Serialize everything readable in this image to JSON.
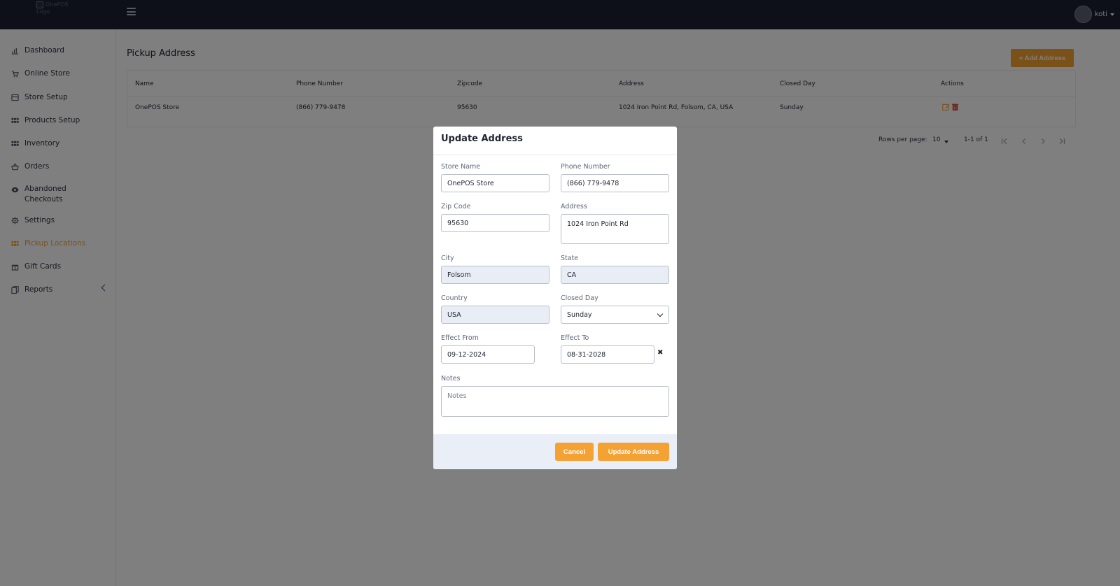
{
  "topbar": {
    "logo_alt": "OnePOS Logo",
    "username": "koti"
  },
  "sidebar": {
    "items": [
      {
        "label": "Dashboard",
        "icon": "bar-chart-icon"
      },
      {
        "label": "Online Store",
        "icon": "cart-icon"
      },
      {
        "label": "Store Setup",
        "icon": "store-icon"
      },
      {
        "label": "Products Setup",
        "icon": "grid-icon"
      },
      {
        "label": "Inventory",
        "icon": "grid-icon"
      },
      {
        "label": "Orders",
        "icon": "basket-icon"
      },
      {
        "label": "Abandoned Checkouts",
        "icon": "eye-icon"
      },
      {
        "label": "Settings",
        "icon": "gear-icon"
      },
      {
        "label": "Pickup Locations",
        "icon": "grid-icon",
        "active": true
      },
      {
        "label": "Gift Cards",
        "icon": "gift-icon"
      },
      {
        "label": "Reports",
        "icon": "report-icon"
      }
    ],
    "active_color": "#f2a33a"
  },
  "main": {
    "title": "Pickup Address",
    "add_button": "+ Add Address",
    "table": {
      "columns": [
        "Name",
        "Phone Number",
        "Zipcode",
        "Address",
        "Closed Day",
        "Actions"
      ],
      "rows": [
        [
          "OnePOS Store",
          "(866) 779-9478",
          "95630",
          "1024 Iron Point Rd, Folsom, CA, USA",
          "Sunday"
        ]
      ]
    },
    "pagination": {
      "rows_per_page_label": "Rows per page:",
      "rows_per_page": "10",
      "range": "1-1 of 1"
    }
  },
  "modal": {
    "title": "Update Address",
    "fields": {
      "store_name": {
        "label": "Store Name",
        "value": "OnePOS Store"
      },
      "phone": {
        "label": "Phone Number",
        "value": "(866) 779-9478"
      },
      "zip": {
        "label": "Zip Code",
        "value": "95630"
      },
      "address": {
        "label": "Address",
        "value": "1024 Iron Point Rd"
      },
      "city": {
        "label": "City",
        "value": "Folsom"
      },
      "state": {
        "label": "State",
        "value": "CA"
      },
      "country": {
        "label": "Country",
        "value": "USA"
      },
      "closed_day": {
        "label": "Closed Day",
        "value": "Sunday"
      },
      "effect_from": {
        "label": "Effect From",
        "value": "09-12-2024"
      },
      "effect_to": {
        "label": "Effect To",
        "value": "08-31-2028"
      },
      "notes": {
        "label": "Notes",
        "placeholder": "Notes"
      }
    },
    "cancel_button": "Cancel",
    "update_button": "Update Address"
  },
  "colors": {
    "accent": "#f4a233",
    "topbar": "#1b2130",
    "delete": "#e0392b"
  }
}
